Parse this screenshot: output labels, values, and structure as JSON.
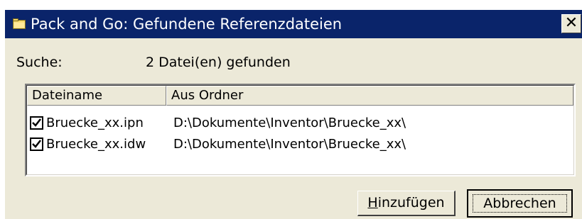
{
  "window": {
    "title": "Pack and Go: Gefundene Referenzdateien",
    "close_glyph": "✕",
    "icon": "folder-icon",
    "title_bg_color": "#0a246a"
  },
  "search": {
    "label": "Suche:",
    "result": "2 Datei(en) gefunden"
  },
  "table": {
    "columns": [
      "Dateiname",
      "Aus Ordner"
    ],
    "rows": [
      {
        "checked": true,
        "name": "Bruecke_xx.ipn",
        "folder": "D:\\Dokumente\\Inventor\\Bruecke_xx\\"
      },
      {
        "checked": true,
        "name": "Bruecke_xx.idw",
        "folder": "D:\\Dokumente\\Inventor\\Bruecke_xx\\"
      }
    ]
  },
  "buttons": {
    "add_first": "H",
    "add_rest": "inzufügen",
    "cancel": "Abbrechen"
  }
}
